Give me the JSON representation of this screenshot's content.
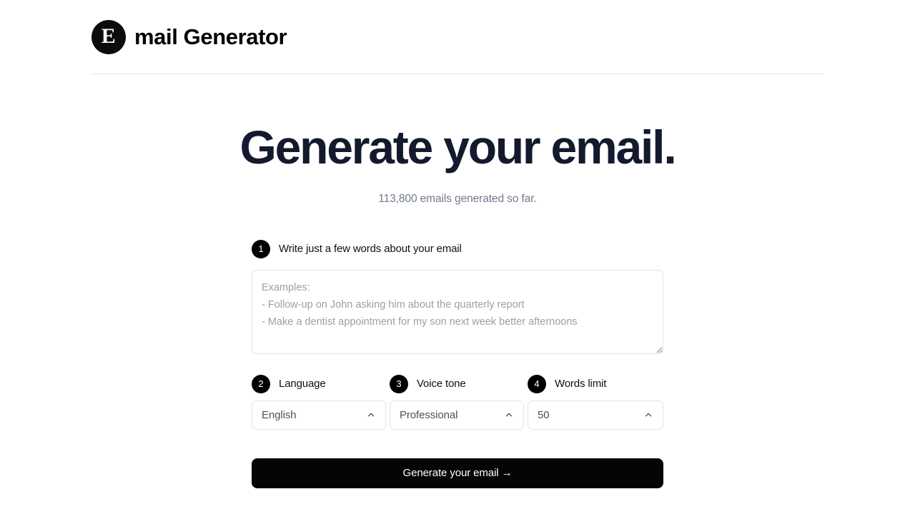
{
  "header": {
    "logo_letter": "E",
    "logo_icon": "circle-e-logo-icon",
    "title": "mail Generator"
  },
  "hero": {
    "title": "Generate your email.",
    "subtitle": "113,800 emails generated so far."
  },
  "form": {
    "step1": {
      "number": "1",
      "label": "Write just a few words about your email",
      "textarea_value": "",
      "textarea_placeholder": "Examples:\n- Follow-up on John asking him about the quarterly report\n- Make a dentist appointment for my son next week better afternoons"
    },
    "step2": {
      "number": "2",
      "label": "Language",
      "selected": "English",
      "chevron": "chevron-up-icon"
    },
    "step3": {
      "number": "3",
      "label": "Voice tone",
      "selected": "Professional",
      "chevron": "chevron-up-icon"
    },
    "step4": {
      "number": "4",
      "label": "Words limit",
      "selected": "50",
      "chevron": "chevron-up-icon"
    },
    "submit_label": "Generate your email →"
  },
  "colors": {
    "page_background": "#ffffff",
    "heading": "#141a2e",
    "muted_text": "#707a8a",
    "badge_background": "#000000",
    "border": "#e3e4e8",
    "divider": "#e8e8ea",
    "button_background": "#050505",
    "button_text": "#ffffff",
    "select_value_text": "#4b5160",
    "placeholder_text": "#9aa0aa"
  }
}
